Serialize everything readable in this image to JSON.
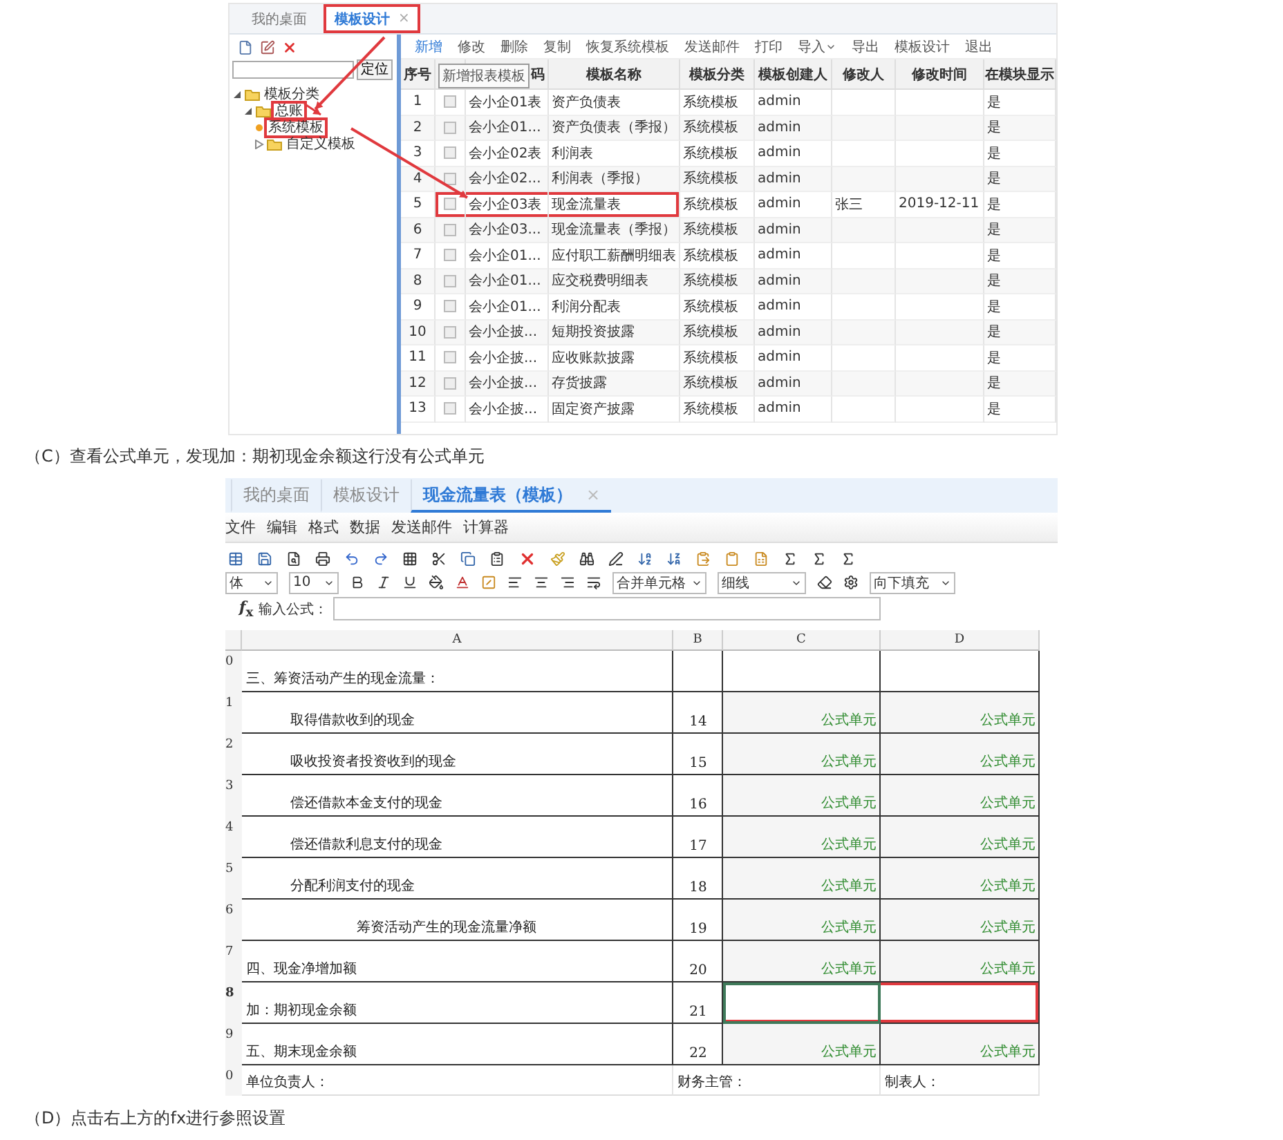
{
  "shot1": {
    "tabs": [
      {
        "label": "我的桌面",
        "selected": false,
        "highlighted": false
      },
      {
        "label": "模板设计",
        "selected": true,
        "highlighted": true,
        "close": "×"
      }
    ],
    "locate_button": "定位",
    "tree": [
      {
        "label": "模板分类",
        "expanded": true,
        "highlighted": false,
        "children": [
          {
            "label": "总账",
            "expanded": true,
            "highlighted": true,
            "children": [
              {
                "label": "系统模板",
                "leaf": true,
                "highlighted": true
              },
              {
                "label": "自定义模板",
                "expanded": false,
                "highlighted": false
              }
            ]
          }
        ]
      }
    ],
    "toolbar": [
      {
        "label": "新增",
        "selected": true
      },
      {
        "label": "修改",
        "selected": false
      },
      {
        "label": "删除",
        "selected": false
      },
      {
        "label": "复制",
        "selected": false
      },
      {
        "label": "恢复系统模板",
        "selected": false
      },
      {
        "label": "发送邮件",
        "selected": false
      },
      {
        "label": "打印",
        "selected": false
      },
      {
        "label": "导入",
        "selected": false,
        "dropdown": true
      },
      {
        "label": "导出",
        "selected": false
      },
      {
        "label": "模板设计",
        "selected": false
      },
      {
        "label": "退出",
        "selected": false
      }
    ],
    "tooltip": "新增报表模板",
    "columns": [
      "序号",
      "",
      "码",
      "模板名称",
      "模板分类",
      "模板创建人",
      "修改人",
      "修改时间",
      "在模块显示"
    ],
    "rows": [
      {
        "no": "1",
        "checked": false,
        "code": "会小企01表",
        "name": "资产负债表",
        "category": "系统模板",
        "creator": "admin",
        "show": "是",
        "highlighted": false
      },
      {
        "no": "2",
        "checked": false,
        "code": "会小企01...",
        "name": "资产负债表（季报）",
        "category": "系统模板",
        "creator": "admin",
        "show": "是",
        "highlighted": false
      },
      {
        "no": "3",
        "checked": false,
        "code": "会小企02表",
        "name": "利润表",
        "category": "系统模板",
        "creator": "admin",
        "show": "是",
        "highlighted": false
      },
      {
        "no": "4",
        "checked": false,
        "code": "会小企02...",
        "name": "利润表（季报）",
        "category": "系统模板",
        "creator": "admin",
        "show": "是",
        "highlighted": false
      },
      {
        "no": "5",
        "checked": false,
        "code": "会小企03表",
        "name": "现金流量表",
        "category": "系统模板",
        "creator": "admin",
        "modifier": "张三",
        "modified": "2019-12-11",
        "show": "是",
        "highlighted": true
      },
      {
        "no": "6",
        "checked": false,
        "code": "会小企03...",
        "name": "现金流量表（季报）",
        "category": "系统模板",
        "creator": "admin",
        "show": "是",
        "highlighted": false
      },
      {
        "no": "7",
        "checked": false,
        "code": "会小企01...",
        "name": "应付职工薪酬明细表",
        "category": "系统模板",
        "creator": "admin",
        "show": "是",
        "highlighted": false
      },
      {
        "no": "8",
        "checked": false,
        "code": "会小企01...",
        "name": "应交税费明细表",
        "category": "系统模板",
        "creator": "admin",
        "show": "是",
        "highlighted": false
      },
      {
        "no": "9",
        "checked": false,
        "code": "会小企01...",
        "name": "利润分配表",
        "category": "系统模板",
        "creator": "admin",
        "show": "是",
        "highlighted": false
      },
      {
        "no": "10",
        "checked": false,
        "code": "会小企披...",
        "name": "短期投资披露",
        "category": "系统模板",
        "creator": "admin",
        "show": "是",
        "highlighted": false
      },
      {
        "no": "11",
        "checked": false,
        "code": "会小企披...",
        "name": "应收账款披露",
        "category": "系统模板",
        "creator": "admin",
        "show": "是",
        "highlighted": false
      },
      {
        "no": "12",
        "checked": false,
        "code": "会小企披...",
        "name": "存货披露",
        "category": "系统模板",
        "creator": "admin",
        "show": "是",
        "highlighted": false
      },
      {
        "no": "13",
        "checked": false,
        "code": "会小企披...",
        "name": "固定资产披露",
        "category": "系统模板",
        "creator": "admin",
        "show": "是",
        "highlighted": false
      }
    ]
  },
  "caption_c": "（C）查看公式单元，发现加：期初现金余额这行没有公式单元",
  "shot2": {
    "tabs": [
      {
        "label": "我的桌面",
        "selected": false
      },
      {
        "label": "模板设计",
        "selected": false
      },
      {
        "label": "现金流量表（模板）",
        "selected": true,
        "close": "×"
      }
    ],
    "menu": [
      "文件",
      "编辑",
      "格式",
      "数据",
      "发送邮件",
      "计算器"
    ],
    "selects": {
      "font": "体",
      "size": "10",
      "merge": "合并单元格",
      "line": "细线",
      "fill": "向下填充"
    },
    "fx": "*f*$_{x}$",
    "formula_label": "输入公式：",
    "columns": [
      "A",
      "B",
      "C",
      "D"
    ],
    "rows": [
      {
        "num": "0",
        "kind": "heading",
        "a": "三、筹资活动产生的现金流量：",
        "shaded": false,
        "selected": false,
        "highlighted": false
      },
      {
        "num": "1",
        "kind": "item",
        "a": "取得借款收到的现金",
        "b": "14",
        "c": "公式单元",
        "d": "公式单元",
        "shaded": true,
        "selected": false,
        "highlighted": false
      },
      {
        "num": "2",
        "kind": "item",
        "a": "吸收投资者投资收到的现金",
        "b": "15",
        "c": "公式单元",
        "d": "公式单元",
        "shaded": true,
        "selected": false,
        "highlighted": false
      },
      {
        "num": "3",
        "kind": "item",
        "a": "偿还借款本金支付的现金",
        "b": "16",
        "c": "公式单元",
        "d": "公式单元",
        "shaded": true,
        "selected": false,
        "highlighted": false
      },
      {
        "num": "4",
        "kind": "item",
        "a": "偿还借款利息支付的现金",
        "b": "17",
        "c": "公式单元",
        "d": "公式单元",
        "shaded": true,
        "selected": false,
        "highlighted": false
      },
      {
        "num": "5",
        "kind": "item",
        "a": "分配利润支付的现金",
        "b": "18",
        "c": "公式单元",
        "d": "公式单元",
        "shaded": true,
        "selected": false,
        "highlighted": false
      },
      {
        "num": "6",
        "kind": "subtotal",
        "a": "筹资活动产生的现金流量净额",
        "b": "19",
        "c": "公式单元",
        "d": "公式单元",
        "shaded": true,
        "selected": false,
        "highlighted": false
      },
      {
        "num": "7",
        "kind": "heading",
        "a": "四、现金净增加额",
        "b": "20",
        "c": "公式单元",
        "d": "公式单元",
        "shaded": true,
        "selected": false,
        "highlighted": false
      },
      {
        "num": "8",
        "kind": "heading",
        "a": "加：期初现金余额",
        "b": "21",
        "shaded": false,
        "selected": true,
        "highlighted": true
      },
      {
        "num": "9",
        "kind": "heading",
        "a": "五、期末现金余额",
        "b": "22",
        "c": "公式单元",
        "d": "公式单元",
        "shaded": true,
        "selected": false,
        "highlighted": false
      },
      {
        "num": "0",
        "kind": "footer",
        "a": "单位负责人：",
        "b": "财务主管：",
        "d": "制表人：",
        "shaded": false,
        "selected": false,
        "highlighted": false
      }
    ]
  },
  "caption_d": "（D）点击右上方的fx进行参照设置"
}
